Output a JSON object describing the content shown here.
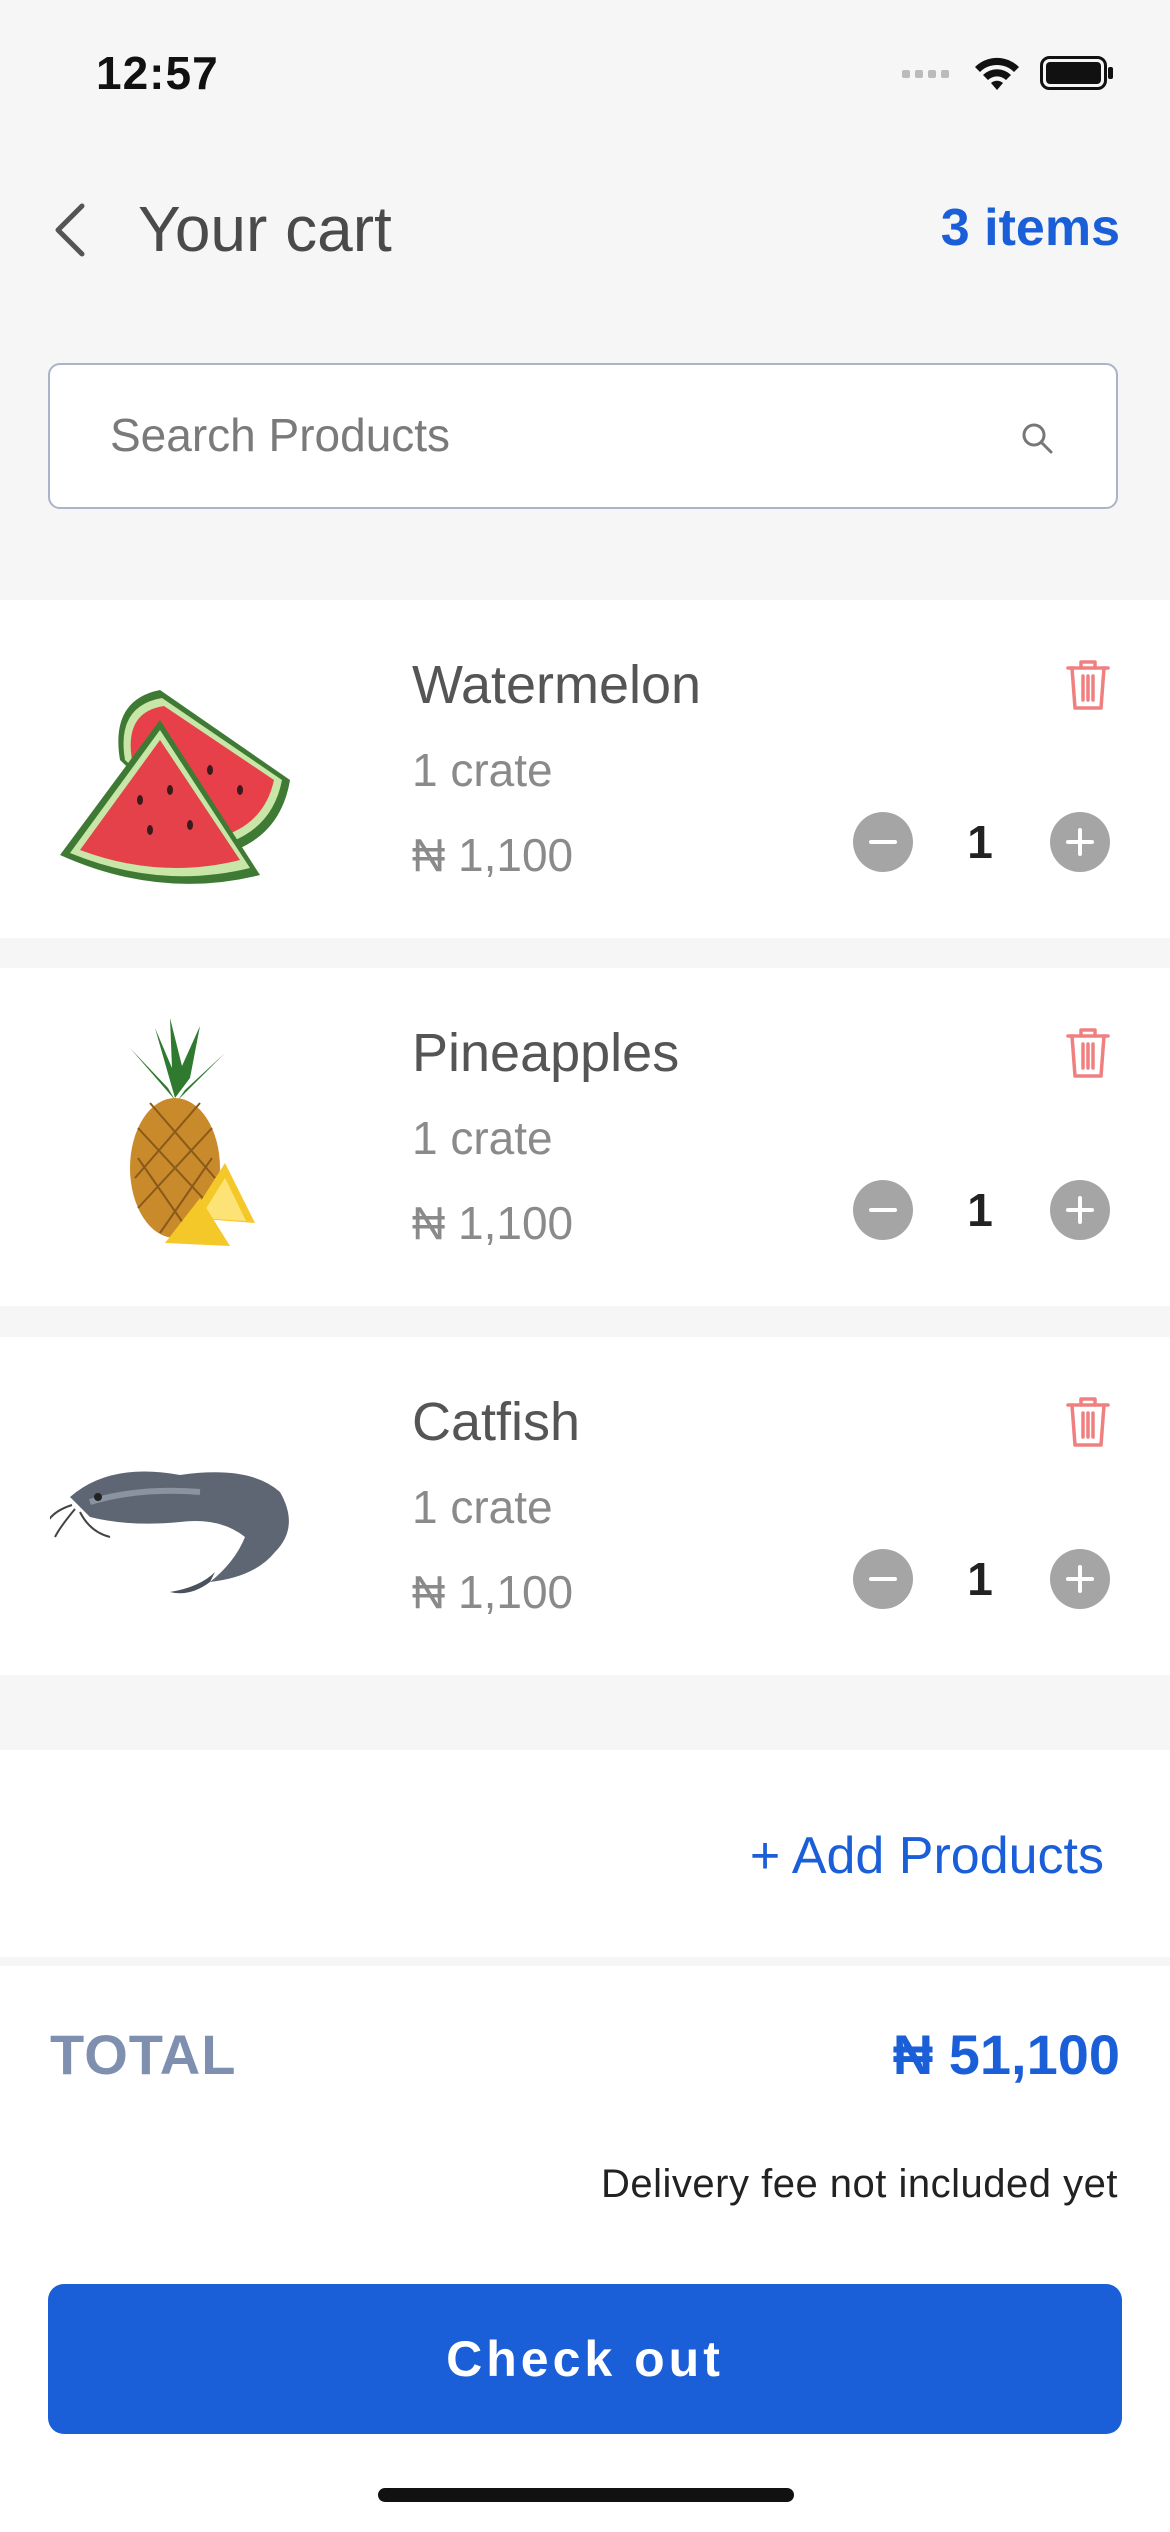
{
  "status_bar": {
    "time": "12:57"
  },
  "header": {
    "title": "Your cart",
    "items_count": "3 items"
  },
  "search": {
    "placeholder": "Search Products",
    "value": ""
  },
  "cart": {
    "items": [
      {
        "name": "Watermelon",
        "unit": "1 crate",
        "price": "₦ 1,100",
        "quantity": "1",
        "image": "watermelon"
      },
      {
        "name": "Pineapples",
        "unit": "1 crate",
        "price": "₦ 1,100",
        "quantity": "1",
        "image": "pineapple"
      },
      {
        "name": "Catfish",
        "unit": "1 crate",
        "price": "₦ 1,100",
        "quantity": "1",
        "image": "catfish"
      }
    ]
  },
  "add_products": {
    "label": "+ Add Products"
  },
  "total": {
    "label": "TOTAL",
    "amount": "₦ 51,100",
    "note": "Delivery fee not included yet"
  },
  "checkout": {
    "label": "Check out"
  },
  "icons": {
    "back": "chevron-left-icon",
    "search": "search-icon",
    "delete": "trash-icon",
    "minus": "minus-circle-icon",
    "plus": "plus-circle-icon"
  },
  "colors": {
    "accent": "#1a5fd8",
    "total_label": "#7e8fb0",
    "delete": "#f08080",
    "qty_button": "#a5a5a5",
    "background": "#F6F6F7"
  }
}
